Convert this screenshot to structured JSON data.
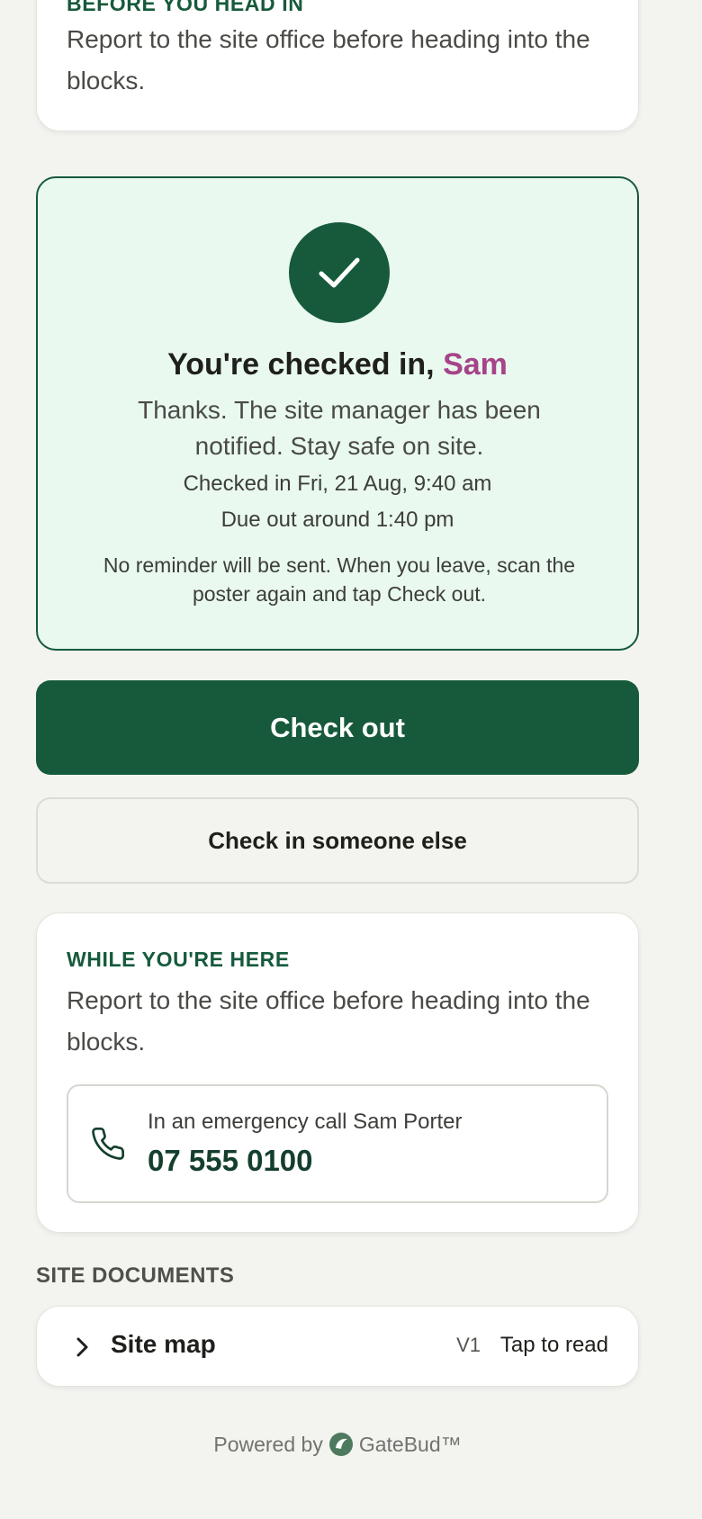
{
  "intro": {
    "eyebrow": "BEFORE YOU HEAD IN",
    "text": "Report to the site office before heading into the blocks."
  },
  "checkin": {
    "title_prefix": "You're checked in, ",
    "name": "Sam",
    "message": "Thanks. The site manager has been notified. Stay safe on site.",
    "checked_in": "Checked in Fri, 21 Aug, 9:40 am",
    "due_out": "Due out around 1:40 pm",
    "note": "No reminder will be sent. When you leave, scan the poster again and tap Check out."
  },
  "actions": {
    "check_out": "Check out",
    "check_in_other": "Check in someone else"
  },
  "info": {
    "eyebrow": "WHILE YOU'RE HERE",
    "text": "Report to the site office before heading into the blocks.",
    "emergency_label": "In an emergency call Sam Porter",
    "emergency_number": "07 555 0100"
  },
  "documents": {
    "heading": "SITE DOCUMENTS",
    "items": [
      {
        "title": "Site map",
        "version": "V1",
        "action": "Tap to read"
      }
    ]
  },
  "footer": {
    "powered_by": "Powered by",
    "brand": "GateBud™"
  },
  "colors": {
    "brand_green": "#165a3b",
    "success_bg": "#e9f9ef",
    "name_accent": "#a64389"
  },
  "icons": [
    "check-icon",
    "phone-icon",
    "chevron-right-icon",
    "gatebud-logo-icon"
  ]
}
